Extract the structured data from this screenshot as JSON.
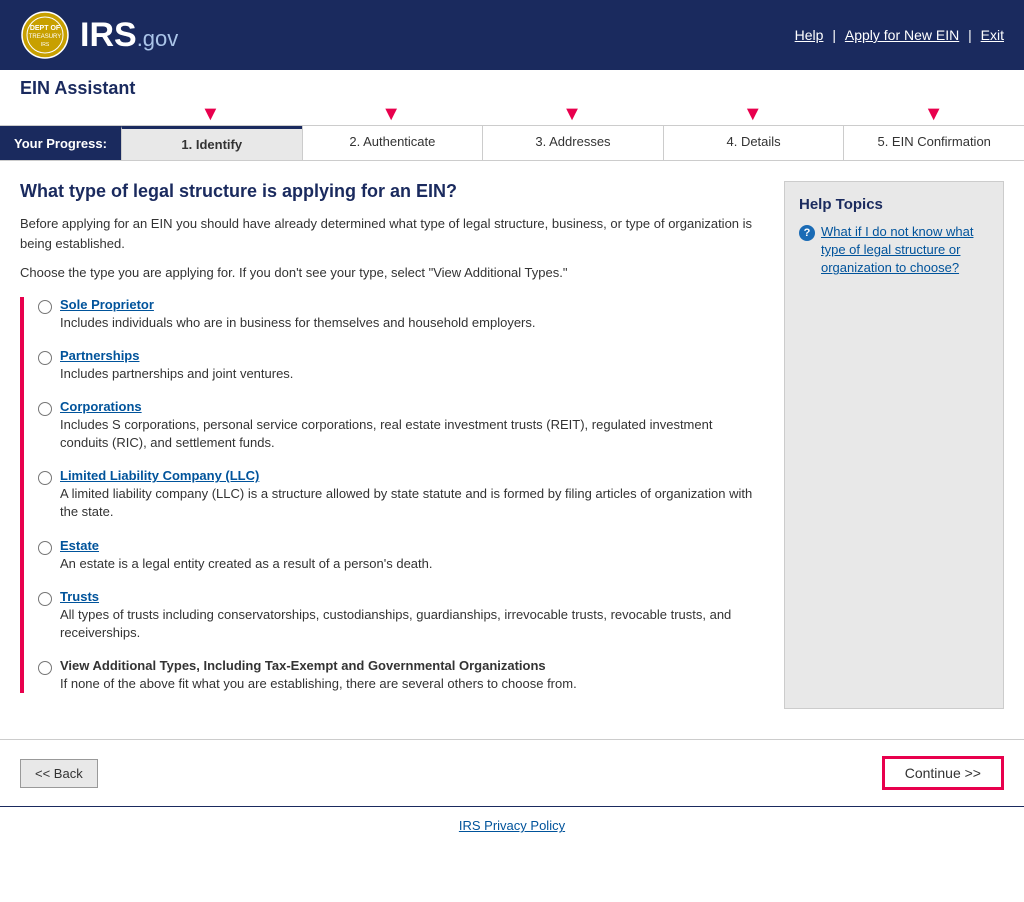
{
  "header": {
    "logo_text": "IRS",
    "logo_suffix": ".gov",
    "nav": {
      "help": "Help",
      "apply": "Apply for New EIN",
      "exit": "Exit"
    }
  },
  "ein_assistant": {
    "title": "EIN Assistant",
    "progress": {
      "label": "Your Progress:",
      "steps": [
        {
          "id": "identify",
          "label": "1. Identify",
          "active": true
        },
        {
          "id": "authenticate",
          "label": "2. Authenticate",
          "active": false
        },
        {
          "id": "addresses",
          "label": "3. Addresses",
          "active": false
        },
        {
          "id": "details",
          "label": "4. Details",
          "active": false
        },
        {
          "id": "ein_confirmation",
          "label": "5. EIN Confirmation",
          "active": false
        }
      ]
    }
  },
  "page": {
    "heading": "What type of legal structure is applying for an EIN?",
    "intro1": "Before applying for an EIN you should have already determined what type of legal structure, business, or type of organization is being established.",
    "intro2": "Choose the type you are applying for. If you don't see your type, select \"View Additional Types.\"",
    "options": [
      {
        "id": "sole_proprietor",
        "label": "Sole Proprietor",
        "desc": "Includes individuals who are in business for themselves and household employers.",
        "bold": false
      },
      {
        "id": "partnerships",
        "label": "Partnerships",
        "desc": "Includes partnerships and joint ventures.",
        "bold": false
      },
      {
        "id": "corporations",
        "label": "Corporations",
        "desc": "Includes S corporations, personal service corporations, real estate investment trusts (REIT), regulated investment conduits (RIC), and settlement funds.",
        "bold": false
      },
      {
        "id": "llc",
        "label": "Limited Liability Company (LLC)",
        "desc": "A limited liability company (LLC) is a structure allowed by state statute and is formed by filing articles of organization with the state.",
        "bold": false
      },
      {
        "id": "estate",
        "label": "Estate",
        "desc": "An estate is a legal entity created as a result of a person's death.",
        "bold": false
      },
      {
        "id": "trusts",
        "label": "Trusts",
        "desc": "All types of trusts including conservatorships, custodianships, guardianships, irrevocable trusts, revocable trusts, and receiverships.",
        "bold": false
      },
      {
        "id": "additional_types",
        "label": "View Additional Types, Including Tax-Exempt and Governmental Organizations",
        "desc": "If none of the above fit what you are establishing, there are several others to choose from.",
        "bold": true
      }
    ]
  },
  "help_topics": {
    "title": "Help Topics",
    "items": [
      {
        "text": "What if I do not know what type of legal structure or organization to choose?"
      }
    ]
  },
  "buttons": {
    "back": "<< Back",
    "continue": "Continue >>"
  },
  "footer": {
    "privacy_policy": "IRS Privacy Policy"
  }
}
